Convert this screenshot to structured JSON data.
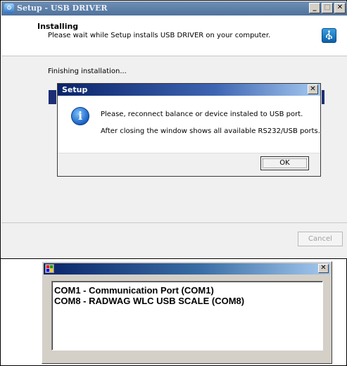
{
  "setup_window": {
    "title": "Setup - USB DRIVER",
    "header_title": "Installing",
    "header_subtitle": "Please wait while Setup installs USB DRIVER on your computer.",
    "status_text": "Finishing installation...",
    "cancel_label": "Cancel",
    "minimize_glyph": "_",
    "maximize_glyph": "□",
    "close_glyph": "✕"
  },
  "dialog": {
    "title": "Setup",
    "close_glyph": "✕",
    "message_line1": "Please, reconnect balance or device instaled to USB port.",
    "message_line2": "After closing the window shows all available RS232/USB ports.",
    "ok_label": "OK",
    "icon": "info-icon"
  },
  "port_window": {
    "close_glyph": "✕",
    "ports": [
      "COM1 - Communication Port (COM1)",
      "COM8 - RADWAG WLC USB SCALE (COM8)"
    ]
  },
  "colors": {
    "title_bar_blue": "#0a246a",
    "progress_blue": "#1b2d74",
    "classic_gray": "#d4d0c8"
  }
}
